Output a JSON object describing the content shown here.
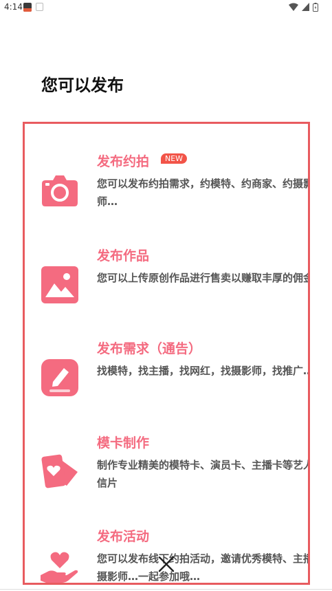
{
  "status_bar": {
    "time": "4:14"
  },
  "heading": "您可以发布",
  "options": [
    {
      "icon": "camera-icon",
      "title": "发布约拍",
      "badge": "NEW",
      "description": "您可以发布约拍需求，约模特、约商家、约摄影师…"
    },
    {
      "icon": "image-icon",
      "title": "发布作品",
      "description": "您可以上传原创作品进行售卖以赚取丰厚的佣金"
    },
    {
      "icon": "edit-icon",
      "title": "发布需求（通告）",
      "description": "找模特，找主播，找网红，找摄影师，找推广…"
    },
    {
      "icon": "cards-heart-icon",
      "title": "模卡制作",
      "description": "制作专业精美的模特卡、演员卡、主播卡等艺人明信片"
    },
    {
      "icon": "hand-heart-icon",
      "title": "发布活动",
      "description": "您可以发布线下约拍活动，邀请优秀模特、主播、摄影师…一起参加哦…"
    }
  ],
  "colors": {
    "accent": "#f46b80",
    "frame": "#e85b5f",
    "badge": "#f25448"
  }
}
